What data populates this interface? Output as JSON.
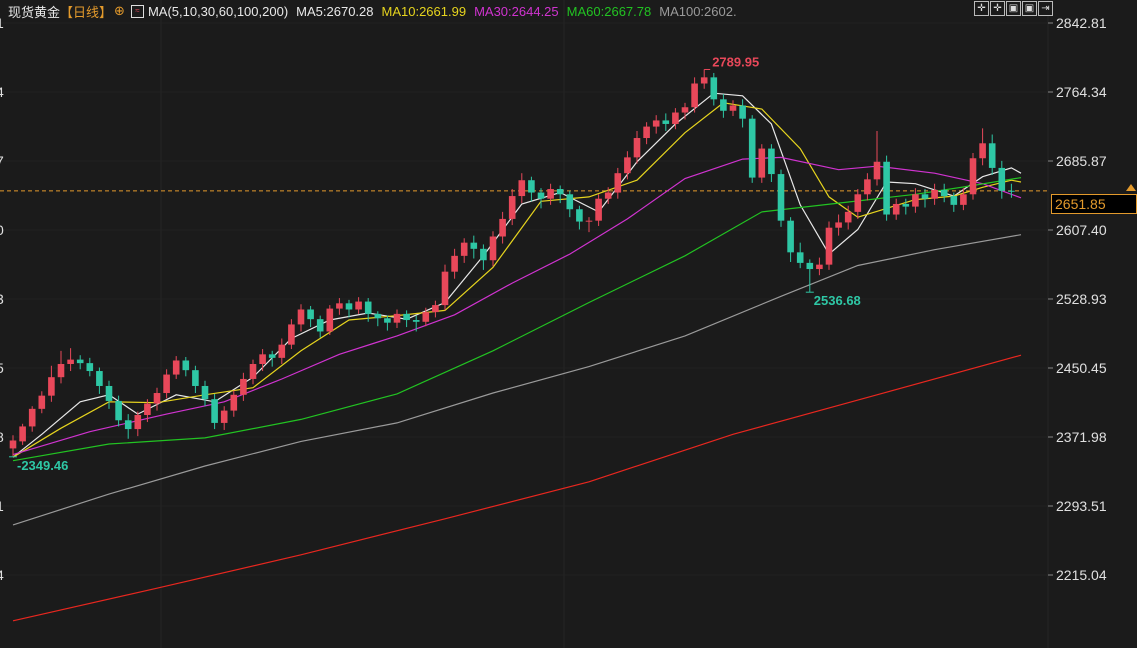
{
  "header": {
    "symbol": "现货黄金",
    "period": "【日线】",
    "ma_title": "MA(5,10,30,60,100,200)",
    "ma_values": [
      {
        "label": "MA5:2670.28",
        "color": "#e8e8e8"
      },
      {
        "label": "MA10:2661.99",
        "color": "#e6d41e"
      },
      {
        "label": "MA30:2644.25",
        "color": "#d033d0"
      },
      {
        "label": "MA60:2667.78",
        "color": "#22c322"
      },
      {
        "label": "MA100:2602.",
        "color": "#9a9a9a"
      }
    ]
  },
  "toolbar": {
    "buttons": [
      "crosshair",
      "crosshair",
      "pane",
      "pane",
      "exit"
    ]
  },
  "current_price": "2651.85",
  "colors": {
    "background": "#1b1b1b",
    "up": "#e8485a",
    "down": "#2ec7a5",
    "ma5": "#e8e8e8",
    "ma10": "#e6d41e",
    "ma30": "#d033d0",
    "ma60": "#22c322",
    "ma100": "#9a9a9a",
    "ma200": "#e8271f",
    "current_line": "#e39a2c",
    "axis_text": "#e0e0e0"
  },
  "chart_data": {
    "type": "candlestick",
    "title": "现货黄金【日线】",
    "y_ticks": [
      2842.81,
      2764.34,
      2685.87,
      2607.4,
      2528.93,
      2450.45,
      2371.98,
      2293.51,
      2215.04
    ],
    "left_partial_ticks": [
      "1",
      "4",
      "7",
      "0",
      "3",
      "5",
      "8",
      "1",
      "4"
    ],
    "annotations": [
      {
        "label": "2789.95",
        "kind": "high",
        "price": 2789.95
      },
      {
        "label": "2536.68",
        "kind": "low",
        "price": 2536.68
      },
      {
        "label": "2349.46",
        "kind": "low",
        "price": 2349.46
      }
    ],
    "candles": [
      [
        2359,
        2368,
        2350,
        2374
      ],
      [
        2367,
        2384,
        2363,
        2387
      ],
      [
        2384,
        2404,
        2378,
        2407
      ],
      [
        2404,
        2419,
        2399,
        2424
      ],
      [
        2419,
        2440,
        2412,
        2453
      ],
      [
        2440,
        2455,
        2433,
        2470
      ],
      [
        2455,
        2460,
        2447,
        2473
      ],
      [
        2460,
        2456,
        2449,
        2465
      ],
      [
        2456,
        2447,
        2441,
        2462
      ],
      [
        2447,
        2430,
        2421,
        2451
      ],
      [
        2430,
        2413,
        2404,
        2436
      ],
      [
        2413,
        2391,
        2384,
        2419
      ],
      [
        2391,
        2381,
        2370,
        2398
      ],
      [
        2381,
        2397,
        2373,
        2401
      ],
      [
        2397,
        2410,
        2389,
        2415
      ],
      [
        2410,
        2422,
        2402,
        2428
      ],
      [
        2422,
        2443,
        2416,
        2449
      ],
      [
        2443,
        2459,
        2438,
        2464
      ],
      [
        2459,
        2448,
        2441,
        2463
      ],
      [
        2448,
        2430,
        2422,
        2453
      ],
      [
        2430,
        2415,
        2407,
        2436
      ],
      [
        2415,
        2388,
        2381,
        2421
      ],
      [
        2388,
        2402,
        2380,
        2407
      ],
      [
        2402,
        2420,
        2395,
        2425
      ],
      [
        2420,
        2438,
        2413,
        2445
      ],
      [
        2438,
        2455,
        2432,
        2460
      ],
      [
        2455,
        2466,
        2447,
        2472
      ],
      [
        2466,
        2462,
        2452,
        2470
      ],
      [
        2462,
        2477,
        2455,
        2484
      ],
      [
        2477,
        2500,
        2472,
        2506
      ],
      [
        2500,
        2517,
        2492,
        2523
      ],
      [
        2517,
        2506,
        2497,
        2521
      ],
      [
        2506,
        2492,
        2485,
        2510
      ],
      [
        2492,
        2518,
        2488,
        2522
      ],
      [
        2518,
        2524,
        2511,
        2530
      ],
      [
        2524,
        2517,
        2508,
        2528
      ],
      [
        2517,
        2526,
        2512,
        2531
      ],
      [
        2526,
        2512,
        2503,
        2530
      ],
      [
        2512,
        2507,
        2498,
        2515
      ],
      [
        2507,
        2502,
        2493,
        2510
      ],
      [
        2502,
        2512,
        2496,
        2517
      ],
      [
        2512,
        2505,
        2497,
        2516
      ],
      [
        2505,
        2503,
        2492,
        2510
      ],
      [
        2503,
        2514,
        2498,
        2519
      ],
      [
        2514,
        2522,
        2508,
        2527
      ],
      [
        2522,
        2560,
        2516,
        2568
      ],
      [
        2560,
        2578,
        2552,
        2586
      ],
      [
        2578,
        2593,
        2570,
        2598
      ],
      [
        2593,
        2586,
        2575,
        2601
      ],
      [
        2586,
        2573,
        2562,
        2591
      ],
      [
        2573,
        2600,
        2566,
        2606
      ],
      [
        2600,
        2620,
        2592,
        2628
      ],
      [
        2620,
        2646,
        2613,
        2654
      ],
      [
        2646,
        2664,
        2638,
        2672
      ],
      [
        2664,
        2650,
        2640,
        2668
      ],
      [
        2650,
        2643,
        2632,
        2655
      ],
      [
        2643,
        2654,
        2636,
        2660
      ],
      [
        2654,
        2648,
        2638,
        2658
      ],
      [
        2648,
        2631,
        2622,
        2652
      ],
      [
        2631,
        2617,
        2608,
        2635
      ],
      [
        2617,
        2618,
        2605,
        2622
      ],
      [
        2618,
        2643,
        2612,
        2648
      ],
      [
        2643,
        2650,
        2637,
        2656
      ],
      [
        2650,
        2672,
        2643,
        2678
      ],
      [
        2672,
        2690,
        2665,
        2697
      ],
      [
        2690,
        2712,
        2683,
        2720
      ],
      [
        2712,
        2725,
        2705,
        2730
      ],
      [
        2725,
        2732,
        2717,
        2738
      ],
      [
        2732,
        2728,
        2720,
        2740
      ],
      [
        2728,
        2741,
        2722,
        2746
      ],
      [
        2741,
        2747,
        2733,
        2752
      ],
      [
        2747,
        2774,
        2741,
        2781
      ],
      [
        2774,
        2781,
        2768,
        2790
      ],
      [
        2781,
        2756,
        2749,
        2786
      ],
      [
        2756,
        2743,
        2735,
        2762
      ],
      [
        2743,
        2749,
        2737,
        2755
      ],
      [
        2749,
        2734,
        2724,
        2756
      ],
      [
        2734,
        2667,
        2661,
        2738
      ],
      [
        2667,
        2700,
        2661,
        2705
      ],
      [
        2700,
        2671,
        2662,
        2705
      ],
      [
        2671,
        2618,
        2611,
        2676
      ],
      [
        2618,
        2582,
        2571,
        2622
      ],
      [
        2582,
        2570,
        2564,
        2593
      ],
      [
        2570,
        2563,
        2537,
        2574
      ],
      [
        2563,
        2568,
        2556,
        2576
      ],
      [
        2568,
        2610,
        2562,
        2617
      ],
      [
        2610,
        2616,
        2601,
        2625
      ],
      [
        2616,
        2628,
        2608,
        2635
      ],
      [
        2628,
        2648,
        2620,
        2654
      ],
      [
        2648,
        2665,
        2641,
        2672
      ],
      [
        2665,
        2685,
        2658,
        2720
      ],
      [
        2685,
        2625,
        2618,
        2692
      ],
      [
        2625,
        2637,
        2619,
        2643
      ],
      [
        2637,
        2634,
        2625,
        2643
      ],
      [
        2634,
        2648,
        2627,
        2655
      ],
      [
        2648,
        2643,
        2633,
        2654
      ],
      [
        2643,
        2653,
        2636,
        2660
      ],
      [
        2653,
        2646,
        2639,
        2660
      ],
      [
        2646,
        2636,
        2628,
        2650
      ],
      [
        2636,
        2648,
        2630,
        2655
      ],
      [
        2648,
        2689,
        2642,
        2695
      ],
      [
        2689,
        2706,
        2681,
        2723
      ],
      [
        2706,
        2678,
        2670,
        2716
      ],
      [
        2678,
        2652,
        2643,
        2686
      ],
      [
        2652,
        2651,
        2644,
        2660
      ]
    ],
    "ma_series": [
      {
        "name": "MA5",
        "key": "ma5",
        "points": [
          [
            0,
            2349
          ],
          [
            3,
            2375
          ],
          [
            7,
            2412
          ],
          [
            10,
            2420
          ],
          [
            13,
            2398
          ],
          [
            17,
            2420
          ],
          [
            21,
            2412
          ],
          [
            25,
            2440
          ],
          [
            29,
            2484
          ],
          [
            33,
            2505
          ],
          [
            37,
            2513
          ],
          [
            41,
            2506
          ],
          [
            45,
            2525
          ],
          [
            49,
            2578
          ],
          [
            53,
            2637
          ],
          [
            57,
            2650
          ],
          [
            61,
            2628
          ],
          [
            65,
            2685
          ],
          [
            69,
            2728
          ],
          [
            73,
            2763
          ],
          [
            76,
            2760
          ],
          [
            79,
            2728
          ],
          [
            82,
            2636
          ],
          [
            85,
            2580
          ],
          [
            88,
            2608
          ],
          [
            91,
            2662
          ],
          [
            94,
            2660
          ],
          [
            98,
            2646
          ],
          [
            101,
            2668
          ],
          [
            104,
            2678
          ],
          [
            105,
            2672
          ]
        ]
      },
      {
        "name": "MA10",
        "key": "ma10",
        "points": [
          [
            0,
            2349
          ],
          [
            5,
            2382
          ],
          [
            10,
            2412
          ],
          [
            15,
            2411
          ],
          [
            20,
            2420
          ],
          [
            25,
            2428
          ],
          [
            30,
            2470
          ],
          [
            35,
            2505
          ],
          [
            40,
            2510
          ],
          [
            45,
            2516
          ],
          [
            50,
            2565
          ],
          [
            55,
            2640
          ],
          [
            60,
            2645
          ],
          [
            65,
            2664
          ],
          [
            70,
            2718
          ],
          [
            74,
            2752
          ],
          [
            78,
            2745
          ],
          [
            82,
            2700
          ],
          [
            85,
            2645
          ],
          [
            88,
            2622
          ],
          [
            91,
            2632
          ],
          [
            94,
            2642
          ],
          [
            98,
            2646
          ],
          [
            101,
            2656
          ],
          [
            104,
            2664
          ],
          [
            105,
            2662
          ]
        ]
      },
      {
        "name": "MA30",
        "key": "ma30",
        "points": [
          [
            0,
            2352
          ],
          [
            8,
            2378
          ],
          [
            16,
            2398
          ],
          [
            22,
            2412
          ],
          [
            28,
            2438
          ],
          [
            34,
            2466
          ],
          [
            40,
            2487
          ],
          [
            46,
            2511
          ],
          [
            52,
            2547
          ],
          [
            58,
            2580
          ],
          [
            64,
            2620
          ],
          [
            70,
            2666
          ],
          [
            76,
            2688
          ],
          [
            80,
            2690
          ],
          [
            86,
            2676
          ],
          [
            90,
            2680
          ],
          [
            96,
            2672
          ],
          [
            101,
            2660
          ],
          [
            105,
            2644
          ]
        ]
      },
      {
        "name": "MA60",
        "key": "ma60",
        "points": [
          [
            0,
            2345
          ],
          [
            10,
            2364
          ],
          [
            20,
            2371
          ],
          [
            30,
            2392
          ],
          [
            40,
            2421
          ],
          [
            50,
            2470
          ],
          [
            60,
            2525
          ],
          [
            70,
            2578
          ],
          [
            78,
            2628
          ],
          [
            86,
            2638
          ],
          [
            94,
            2648
          ],
          [
            100,
            2658
          ],
          [
            105,
            2667
          ]
        ]
      },
      {
        "name": "MA100",
        "key": "ma100",
        "points": [
          [
            0,
            2272
          ],
          [
            10,
            2307
          ],
          [
            20,
            2339
          ],
          [
            30,
            2367
          ],
          [
            40,
            2388
          ],
          [
            50,
            2422
          ],
          [
            60,
            2452
          ],
          [
            70,
            2487
          ],
          [
            80,
            2532
          ],
          [
            88,
            2567
          ],
          [
            96,
            2585
          ],
          [
            105,
            2602
          ]
        ]
      },
      {
        "name": "MA200",
        "key": "ma200",
        "points": [
          [
            0,
            2163
          ],
          [
            15,
            2200
          ],
          [
            30,
            2238
          ],
          [
            45,
            2279
          ],
          [
            60,
            2321
          ],
          [
            75,
            2375
          ],
          [
            90,
            2420
          ],
          [
            105,
            2465
          ]
        ]
      }
    ]
  }
}
